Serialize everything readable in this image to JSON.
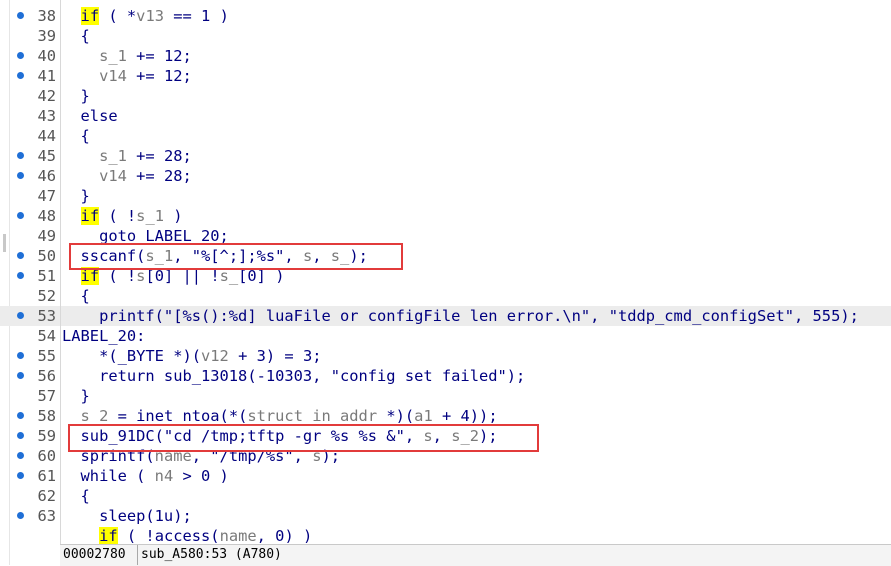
{
  "editor": {
    "lines": [
      {
        "num": "38",
        "dot": true,
        "segments": [
          {
            "t": "  "
          },
          {
            "t": "if",
            "c": "kw"
          },
          {
            "t": " ( *"
          },
          {
            "t": "v13",
            "c": "var"
          },
          {
            "t": " == 1 )"
          }
        ]
      },
      {
        "num": "39",
        "dot": false,
        "segments": [
          {
            "t": "  {"
          }
        ]
      },
      {
        "num": "40",
        "dot": true,
        "segments": [
          {
            "t": "    "
          },
          {
            "t": "s_1",
            "c": "var"
          },
          {
            "t": " += 12;"
          }
        ]
      },
      {
        "num": "41",
        "dot": true,
        "segments": [
          {
            "t": "    "
          },
          {
            "t": "v14",
            "c": "var"
          },
          {
            "t": " += 12;"
          }
        ]
      },
      {
        "num": "42",
        "dot": false,
        "segments": [
          {
            "t": "  }"
          }
        ]
      },
      {
        "num": "43",
        "dot": false,
        "segments": [
          {
            "t": "  else"
          }
        ]
      },
      {
        "num": "44",
        "dot": false,
        "segments": [
          {
            "t": "  {"
          }
        ]
      },
      {
        "num": "45",
        "dot": true,
        "segments": [
          {
            "t": "    "
          },
          {
            "t": "s_1",
            "c": "var"
          },
          {
            "t": " += 28;"
          }
        ]
      },
      {
        "num": "46",
        "dot": true,
        "segments": [
          {
            "t": "    "
          },
          {
            "t": "v14",
            "c": "var"
          },
          {
            "t": " += 28;"
          }
        ]
      },
      {
        "num": "47",
        "dot": false,
        "segments": [
          {
            "t": "  }"
          }
        ]
      },
      {
        "num": "48",
        "dot": true,
        "segments": [
          {
            "t": "  "
          },
          {
            "t": "if",
            "c": "kw"
          },
          {
            "t": " ( !"
          },
          {
            "t": "s_1",
            "c": "var"
          },
          {
            "t": " )"
          }
        ]
      },
      {
        "num": "49",
        "dot": false,
        "segments": [
          {
            "t": "    goto LABEL_20;"
          }
        ]
      },
      {
        "num": "50",
        "dot": true,
        "segments": [
          {
            "t": "  sscanf("
          },
          {
            "t": "s_1",
            "c": "var"
          },
          {
            "t": ", \"%[^;];%s\", "
          },
          {
            "t": "s",
            "c": "var"
          },
          {
            "t": ", "
          },
          {
            "t": "s_",
            "c": "var"
          },
          {
            "t": ");"
          }
        ]
      },
      {
        "num": "51",
        "dot": true,
        "segments": [
          {
            "t": "  "
          },
          {
            "t": "if",
            "c": "kw"
          },
          {
            "t": " ( !"
          },
          {
            "t": "s",
            "c": "var"
          },
          {
            "t": "[0] || !"
          },
          {
            "t": "s_",
            "c": "var"
          },
          {
            "t": "[0] )"
          }
        ]
      },
      {
        "num": "52",
        "dot": false,
        "segments": [
          {
            "t": "  {"
          }
        ]
      },
      {
        "num": "53",
        "dot": true,
        "hl": true,
        "segments": [
          {
            "t": "    printf(\"[%s():%d] luaFile or configFile len error.\\n\", \"tddp_cmd_configSet\", 555);"
          }
        ]
      },
      {
        "num": "54",
        "dot": false,
        "segments": [
          {
            "t": "LABEL_20:"
          }
        ]
      },
      {
        "num": "55",
        "dot": true,
        "segments": [
          {
            "t": "    *(_BYTE *)("
          },
          {
            "t": "v12",
            "c": "var"
          },
          {
            "t": " + 3) = 3;"
          }
        ]
      },
      {
        "num": "56",
        "dot": true,
        "segments": [
          {
            "t": "    return sub_13018(-10303, \"config set failed\");"
          }
        ]
      },
      {
        "num": "57",
        "dot": false,
        "segments": [
          {
            "t": "  }"
          }
        ]
      },
      {
        "num": "58",
        "dot": true,
        "segments": [
          {
            "t": "  "
          },
          {
            "t": "s_2",
            "c": "var"
          },
          {
            "t": " = inet_ntoa(*("
          },
          {
            "t": "struct in_addr",
            "c": "var"
          },
          {
            "t": " *)("
          },
          {
            "t": "a1",
            "c": "var"
          },
          {
            "t": " + 4));"
          }
        ]
      },
      {
        "num": "59",
        "dot": true,
        "segments": [
          {
            "t": "  sub_91DC(\"cd /tmp;tftp -gr %s %s &\", "
          },
          {
            "t": "s",
            "c": "var"
          },
          {
            "t": ", "
          },
          {
            "t": "s_2",
            "c": "var"
          },
          {
            "t": ");"
          }
        ]
      },
      {
        "num": "60",
        "dot": true,
        "segments": [
          {
            "t": "  sprintf("
          },
          {
            "t": "name",
            "c": "var"
          },
          {
            "t": ", \"/tmp/%s\", "
          },
          {
            "t": "s",
            "c": "var"
          },
          {
            "t": ");"
          }
        ]
      },
      {
        "num": "61",
        "dot": true,
        "segments": [
          {
            "t": "  while ( "
          },
          {
            "t": "n4",
            "c": "var"
          },
          {
            "t": " > 0 )"
          }
        ]
      },
      {
        "num": "62",
        "dot": false,
        "segments": [
          {
            "t": "  {"
          }
        ]
      },
      {
        "num": "63",
        "dot": true,
        "segments": [
          {
            "t": "    sleep(1u);"
          }
        ]
      },
      {
        "num": "",
        "dot": false,
        "segments": [
          {
            "t": "    "
          },
          {
            "t": "if",
            "c": "kw"
          },
          {
            "t": " ( !access("
          },
          {
            "t": "name",
            "c": "var"
          },
          {
            "t": ", 0) )"
          }
        ]
      }
    ]
  },
  "annotations": {
    "highlight_color": "#e23b3b",
    "boxed_lines": [
      "50",
      "59"
    ]
  },
  "status": {
    "address": "00002780",
    "function": "sub_A580:53 (A780)"
  },
  "colors": {
    "code_text": "#000080",
    "variable": "#7a7a7a",
    "keyword_highlight": "#ffff00",
    "breakpoint_dot": "#1f6fd6",
    "current_line": "#ececec"
  }
}
